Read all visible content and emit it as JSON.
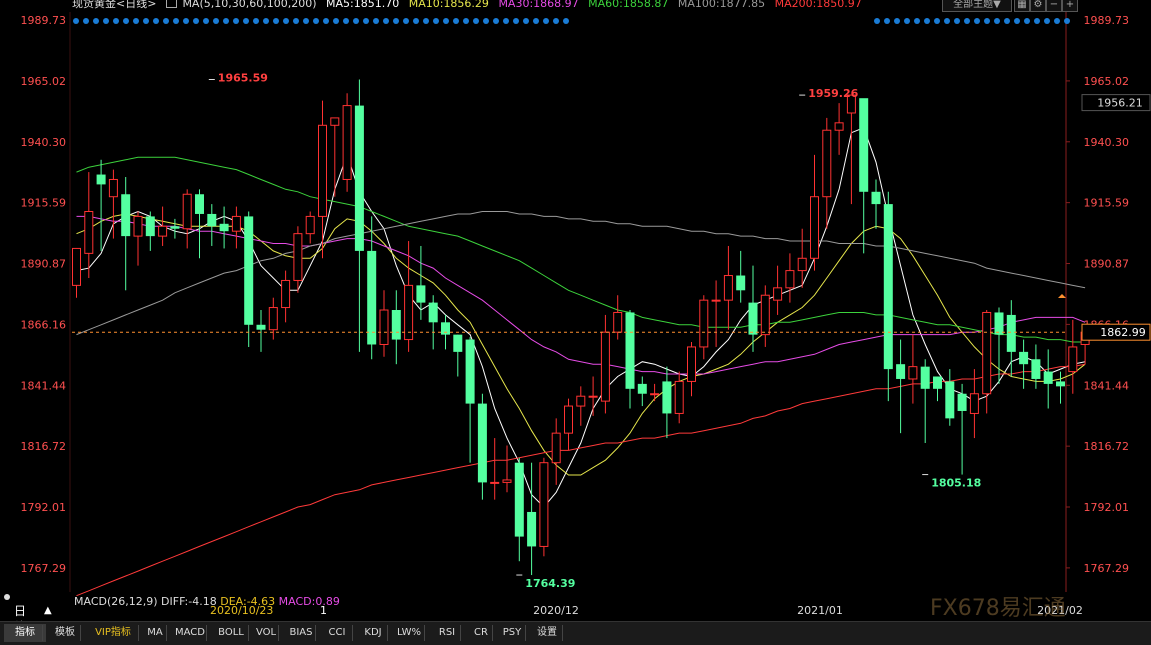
{
  "header": {
    "symbol": "现货黄金<日线>",
    "ma_params": "MA(5,10,30,60,100,200)",
    "ma5": "MA5:1851.70",
    "ma10": "MA10:1856.29",
    "ma30": "MA30:1868.97",
    "ma60": "MA60:1858.87",
    "ma100": "MA100:1877.85",
    "ma200": "MA200:1850.97",
    "dropdown": "全部主题▼"
  },
  "colors": {
    "up": "#ff3232",
    "down": "#54ffa0",
    "ma5": "#ffffff",
    "ma10": "#e6e64c",
    "ma30": "#e64ce6",
    "ma60": "#3cd23c",
    "ma100": "#9a9a9a",
    "ma200": "#ff3a3a",
    "axis_text": "#ff5050",
    "grid": "#5a1a1a",
    "price_line": "#ff9030"
  },
  "chart_data": {
    "type": "candlestick",
    "ylim": [
      1757.5,
      1993.0
    ],
    "y_ticks": [
      "1989.73",
      "1965.02",
      "1940.30",
      "1915.59",
      "1890.87",
      "1866.16",
      "1841.44",
      "1816.72",
      "1792.01",
      "1767.29"
    ],
    "current_price": "1956.21",
    "last_price_label": "1862.99",
    "x_labels": [
      "2020/12",
      "2021/01",
      "2021/02"
    ],
    "annotations": [
      {
        "text": "1965.59",
        "value": 1965.59,
        "bar": 11,
        "kind": "high"
      },
      {
        "text": "1764.39",
        "value": 1764.39,
        "bar": 36,
        "kind": "low"
      },
      {
        "text": "1959.26",
        "value": 1959.26,
        "bar": 59,
        "kind": "high"
      },
      {
        "text": "1805.18",
        "value": 1805.18,
        "bar": 69,
        "kind": "low"
      }
    ],
    "ohlc": [
      [
        1882,
        1897,
        1877,
        1894
      ],
      [
        1895,
        1912,
        1885,
        1928
      ],
      [
        1927,
        1923,
        1896,
        1933
      ],
      [
        1918,
        1925,
        1901,
        1929
      ],
      [
        1919,
        1902,
        1880,
        1926
      ],
      [
        1902,
        1910,
        1890,
        1912
      ],
      [
        1910,
        1902,
        1896,
        1912
      ],
      [
        1902,
        1906,
        1898,
        1914
      ],
      [
        1906,
        1905,
        1901,
        1909
      ],
      [
        1905,
        1919,
        1897,
        1921
      ],
      [
        1919,
        1911,
        1893,
        1921
      ],
      [
        1911,
        1906,
        1898,
        1915
      ],
      [
        1907,
        1904,
        1897,
        1914
      ],
      [
        1904,
        1910,
        1897,
        1914
      ],
      [
        1910,
        1866,
        1857,
        1912
      ],
      [
        1866,
        1864,
        1855,
        1872
      ],
      [
        1864,
        1873,
        1860,
        1877
      ],
      [
        1873,
        1884,
        1867,
        1888
      ],
      [
        1884,
        1903,
        1879,
        1906
      ],
      [
        1903,
        1910,
        1899,
        1912
      ],
      [
        1910,
        1947,
        1893,
        1957
      ],
      [
        1947,
        1950,
        1918,
        1950
      ],
      [
        1925,
        1955,
        1920,
        1960
      ],
      [
        1955,
        1896,
        1855,
        1965.59
      ],
      [
        1896,
        1858,
        1852,
        1910
      ],
      [
        1858,
        1872,
        1853,
        1880
      ],
      [
        1872,
        1860,
        1850,
        1880
      ],
      [
        1860,
        1882,
        1855,
        1900
      ],
      [
        1882,
        1875,
        1868,
        1898
      ],
      [
        1875,
        1867,
        1856,
        1878
      ],
      [
        1867,
        1862,
        1856,
        1870
      ],
      [
        1862,
        1855,
        1845,
        1862
      ],
      [
        1860,
        1834,
        1810,
        1861
      ],
      [
        1834,
        1802,
        1795,
        1838
      ],
      [
        1802,
        1802,
        1795,
        1820
      ],
      [
        1802,
        1803,
        1798,
        1817
      ],
      [
        1810,
        1780,
        1770,
        1812
      ],
      [
        1790,
        1776,
        1764.39,
        1810
      ],
      [
        1776,
        1810,
        1772,
        1812
      ],
      [
        1810,
        1822,
        1801,
        1828
      ],
      [
        1822,
        1833,
        1815,
        1836
      ],
      [
        1833,
        1837,
        1825,
        1841
      ],
      [
        1837,
        1837,
        1829,
        1845
      ],
      [
        1835,
        1863,
        1830,
        1870
      ],
      [
        1863,
        1871,
        1860,
        1878
      ],
      [
        1871,
        1840,
        1832,
        1872
      ],
      [
        1842,
        1838,
        1833,
        1845
      ],
      [
        1838,
        1838,
        1835,
        1842
      ],
      [
        1843,
        1830,
        1820,
        1849
      ],
      [
        1830,
        1843,
        1826,
        1847
      ],
      [
        1843,
        1857,
        1837,
        1859
      ],
      [
        1857,
        1876,
        1852,
        1878
      ],
      [
        1876,
        1876,
        1857,
        1884
      ],
      [
        1876,
        1886,
        1864,
        1898
      ],
      [
        1886,
        1880,
        1875,
        1896
      ],
      [
        1875,
        1862,
        1855,
        1890
      ],
      [
        1862,
        1878,
        1857,
        1882
      ],
      [
        1876,
        1881,
        1870,
        1890
      ],
      [
        1881,
        1888,
        1875,
        1895
      ],
      [
        1888,
        1893,
        1881,
        1905
      ],
      [
        1893,
        1918,
        1888,
        1935
      ],
      [
        1918,
        1945,
        1905,
        1950
      ],
      [
        1945,
        1948,
        1935,
        1956
      ],
      [
        1952,
        1959.26,
        1915,
        1959.26
      ],
      [
        1958,
        1920,
        1895,
        1938
      ],
      [
        1920,
        1915,
        1905,
        1925
      ],
      [
        1915,
        1848,
        1835,
        1920
      ],
      [
        1850,
        1844,
        1822,
        1860
      ],
      [
        1844,
        1849,
        1834,
        1862
      ],
      [
        1849,
        1840,
        1818,
        1852
      ],
      [
        1845,
        1840,
        1835,
        1845
      ],
      [
        1843,
        1828,
        1825,
        1848
      ],
      [
        1838,
        1831,
        1805.18,
        1842
      ],
      [
        1830,
        1838,
        1820,
        1848
      ],
      [
        1838,
        1871,
        1830,
        1872
      ],
      [
        1871,
        1862,
        1842,
        1873
      ],
      [
        1870,
        1855,
        1845,
        1876
      ],
      [
        1855,
        1850,
        1840,
        1860
      ],
      [
        1852,
        1844,
        1840,
        1858
      ],
      [
        1847,
        1842,
        1832,
        1856
      ],
      [
        1843,
        1841,
        1834,
        1847
      ],
      [
        1847,
        1857,
        1838,
        1868
      ],
      [
        1858,
        1862.99,
        1850,
        1866
      ]
    ],
    "series": [
      {
        "name": "MA5",
        "key": "ma5",
        "y": [
          1888,
          1889,
          1895,
          1907,
          1910,
          1912,
          1910,
          1906,
          1904,
          1903,
          1905,
          1908,
          1910,
          1908,
          1900,
          1890,
          1885,
          1880,
          1880,
          1890,
          1900,
          1921,
          1935,
          1920,
          1912,
          1905,
          1890,
          1878,
          1872,
          1875,
          1870,
          1866,
          1862,
          1849,
          1832,
          1820,
          1810,
          1797,
          1792,
          1798,
          1808,
          1818,
          1832,
          1840,
          1845,
          1848,
          1851,
          1850,
          1848,
          1846,
          1845,
          1849,
          1855,
          1860,
          1868,
          1874,
          1876,
          1878,
          1880,
          1882,
          1893,
          1906,
          1921,
          1944,
          1946,
          1932,
          1910,
          1890,
          1870,
          1858,
          1847,
          1840,
          1838,
          1835,
          1837,
          1843,
          1851,
          1853,
          1851,
          1846,
          1848,
          1850,
          1851
        ]
      },
      {
        "name": "MA10",
        "key": "ma10",
        "y": [
          1903,
          1905,
          1908,
          1910,
          1911,
          1910,
          1909,
          1908,
          1907,
          1906,
          1906,
          1906,
          1906,
          1906,
          1904,
          1900,
          1896,
          1894,
          1893,
          1893,
          1897,
          1905,
          1909,
          1908,
          1904,
          1899,
          1893,
          1889,
          1886,
          1883,
          1878,
          1872,
          1867,
          1858,
          1849,
          1840,
          1832,
          1823,
          1815,
          1809,
          1805,
          1805,
          1808,
          1811,
          1816,
          1822,
          1830,
          1836,
          1840,
          1843,
          1845,
          1846,
          1848,
          1850,
          1854,
          1859,
          1863,
          1867,
          1870,
          1873,
          1878,
          1885,
          1892,
          1899,
          1904,
          1906,
          1905,
          1901,
          1894,
          1886,
          1878,
          1869,
          1863,
          1857,
          1852,
          1848,
          1845,
          1844,
          1843,
          1843,
          1844,
          1846,
          1850
        ]
      },
      {
        "name": "MA30",
        "key": "ma30",
        "y": [
          1910,
          1910,
          1909,
          1908,
          1908,
          1907,
          1906,
          1906,
          1906,
          1905,
          1904,
          1904,
          1903,
          1902,
          1901,
          1900,
          1899,
          1899,
          1898,
          1898,
          1899,
          1900,
          1901,
          1901,
          1900,
          1898,
          1896,
          1894,
          1891,
          1889,
          1885,
          1882,
          1879,
          1876,
          1872,
          1868,
          1864,
          1860,
          1857,
          1855,
          1852,
          1851,
          1850,
          1850,
          1849,
          1848,
          1847,
          1847,
          1846,
          1846,
          1846,
          1846,
          1847,
          1848,
          1849,
          1850,
          1851,
          1851,
          1852,
          1853,
          1854,
          1856,
          1858,
          1859,
          1860,
          1861,
          1862,
          1862,
          1862,
          1862,
          1862,
          1862,
          1863,
          1863,
          1864,
          1865,
          1867,
          1868,
          1869,
          1869,
          1869,
          1869,
          1867
        ]
      },
      {
        "name": "MA60",
        "key": "ma60",
        "y": [
          1928,
          1930,
          1931,
          1932,
          1933,
          1934,
          1934,
          1934,
          1934,
          1933,
          1932,
          1931,
          1930,
          1929,
          1927,
          1925,
          1923,
          1921,
          1920,
          1918,
          1917,
          1916,
          1915,
          1914,
          1912,
          1910,
          1908,
          1906,
          1905,
          1904,
          1903,
          1902,
          1900,
          1898,
          1896,
          1894,
          1892,
          1889,
          1886,
          1883,
          1880,
          1878,
          1876,
          1874,
          1872,
          1871,
          1869,
          1868,
          1867,
          1866,
          1866,
          1865,
          1865,
          1865,
          1865,
          1866,
          1866,
          1867,
          1867,
          1868,
          1869,
          1870,
          1871,
          1871,
          1871,
          1870,
          1870,
          1869,
          1868,
          1867,
          1866,
          1866,
          1865,
          1864,
          1863,
          1862,
          1862,
          1861,
          1861,
          1860,
          1860,
          1859,
          1859
        ]
      },
      {
        "name": "MA100",
        "key": "ma100",
        "y": [
          1862,
          1864,
          1866,
          1868,
          1870,
          1872,
          1874,
          1876,
          1879,
          1881,
          1883,
          1885,
          1887,
          1888,
          1890,
          1892,
          1893,
          1895,
          1896,
          1898,
          1899,
          1901,
          1902,
          1903,
          1904,
          1905,
          1906,
          1907,
          1908,
          1909,
          1910,
          1911,
          1911,
          1912,
          1912,
          1912,
          1911,
          1911,
          1910,
          1910,
          1909,
          1909,
          1908,
          1908,
          1907,
          1907,
          1906,
          1906,
          1906,
          1905,
          1904,
          1904,
          1903,
          1903,
          1902,
          1902,
          1901,
          1901,
          1900,
          1900,
          1900,
          1900,
          1899,
          1899,
          1899,
          1898,
          1898,
          1897,
          1896,
          1895,
          1894,
          1893,
          1892,
          1891,
          1889,
          1888,
          1887,
          1886,
          1885,
          1884,
          1883,
          1882,
          1881
        ]
      },
      {
        "name": "MA200",
        "key": "ma200",
        "y": [
          1756,
          1758,
          1760,
          1762,
          1764,
          1766,
          1768,
          1770,
          1772,
          1774,
          1776,
          1778,
          1780,
          1782,
          1784,
          1786,
          1788,
          1790,
          1792,
          1793,
          1795,
          1797,
          1798,
          1799,
          1801,
          1802,
          1803,
          1804,
          1805,
          1806,
          1807,
          1808,
          1809,
          1810,
          1811,
          1811,
          1812,
          1813,
          1814,
          1815,
          1815,
          1816,
          1817,
          1818,
          1818,
          1819,
          1820,
          1820,
          1821,
          1822,
          1822,
          1823,
          1824,
          1825,
          1826,
          1828,
          1829,
          1831,
          1832,
          1834,
          1835,
          1836,
          1837,
          1838,
          1839,
          1840,
          1840,
          1841,
          1842,
          1842,
          1843,
          1843,
          1844,
          1844,
          1845,
          1846,
          1846,
          1847,
          1847,
          1848,
          1849,
          1849,
          1850
        ]
      }
    ]
  },
  "macd": {
    "label": "MACD(26,12,9)",
    "diff": "DIFF:-4.18",
    "dea": "DEA:-4.63",
    "macd": "MACD:0.89"
  },
  "period": {
    "label": "日线",
    "arrow": "▲",
    "date": "2020/10/23 星期五",
    "num": "1"
  },
  "tabs": [
    "指标",
    "模板",
    "VIP指标",
    "MA",
    "MACD",
    "BOLL",
    "VOL",
    "BIAS",
    "CCI",
    "KDJ",
    "LW%",
    "RSI",
    "CR",
    "PSY",
    "设置"
  ],
  "watermark": "FX678易汇通"
}
